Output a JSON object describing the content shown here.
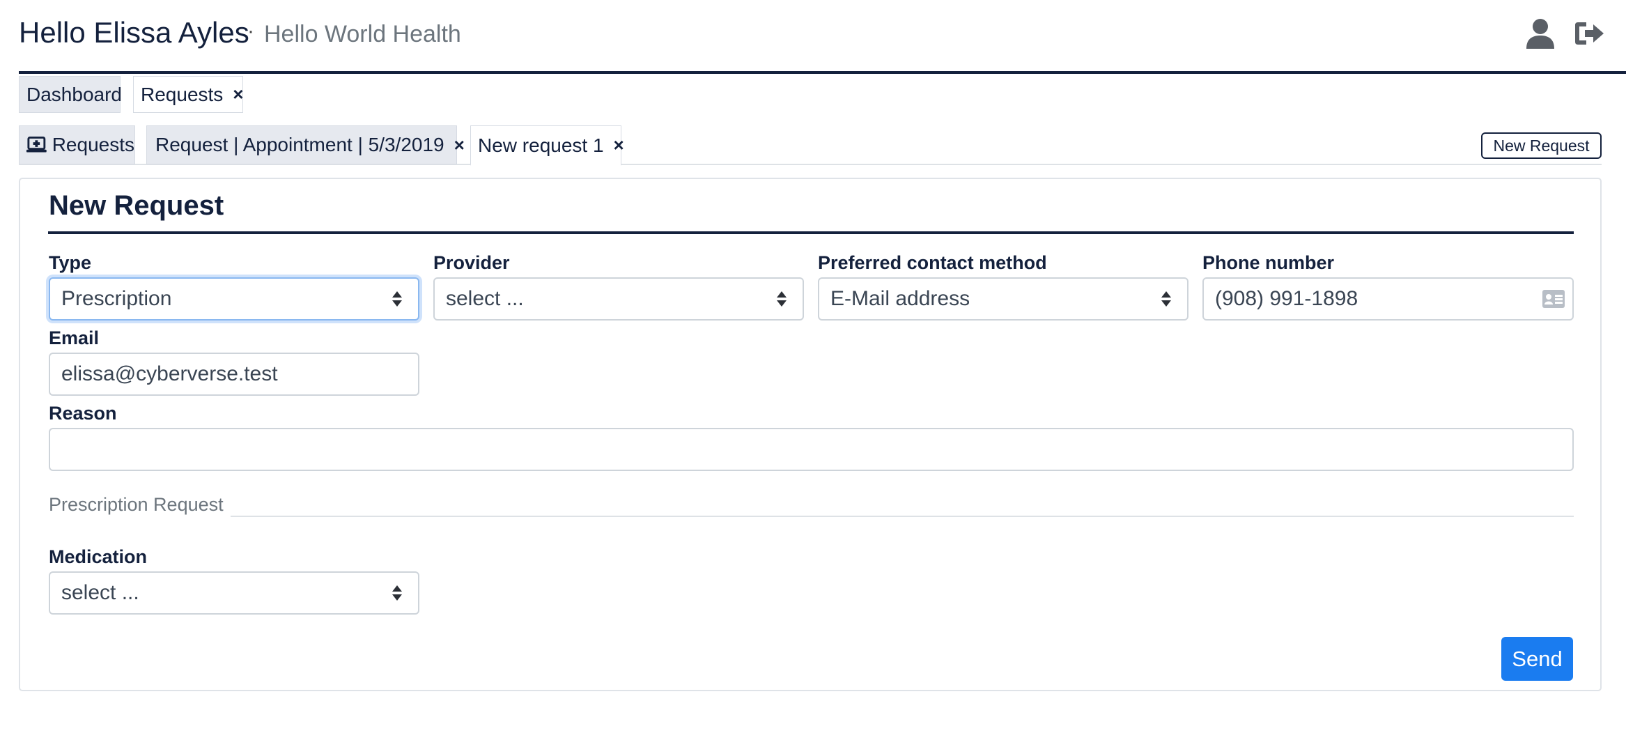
{
  "header": {
    "greeting": "Hello Elissa Ayles",
    "separator": "·",
    "organization": "Hello World Health",
    "user_icon": "user-icon",
    "logout_icon": "sign-out-icon"
  },
  "top_tabs": {
    "dashboard": "Dashboard",
    "requests": "Requests",
    "close_glyph": "×"
  },
  "sub_tabs": {
    "requests": "Requests",
    "appointment": "Request | Appointment | 5/3/2019",
    "new_request": "New request 1",
    "close_glyph": "×",
    "new_request_button": "New Request"
  },
  "form": {
    "title": "New Request",
    "type": {
      "label": "Type",
      "value": "Prescription"
    },
    "provider": {
      "label": "Provider",
      "value": "select ..."
    },
    "contact": {
      "label": "Preferred contact method",
      "value": "E-Mail address"
    },
    "phone": {
      "label": "Phone number",
      "value": "(908) 991-1898"
    },
    "email": {
      "label": "Email",
      "value": "elissa@cyberverse.test"
    },
    "reason": {
      "label": "Reason",
      "value": ""
    },
    "section_legend": "Prescription Request",
    "medication": {
      "label": "Medication",
      "value": "select ..."
    },
    "send_button": "Send"
  },
  "colors": {
    "primary_navy": "#14213d",
    "accent_blue": "#1a7cf0",
    "focus_ring": "#cfe2fb"
  }
}
